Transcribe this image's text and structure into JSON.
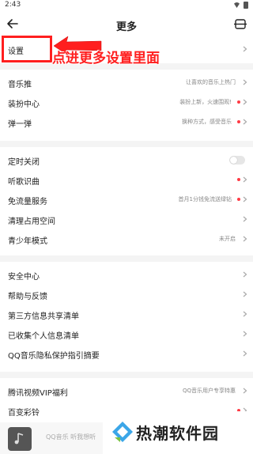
{
  "status_bar": {
    "time": "2:43"
  },
  "header": {
    "title": "更多"
  },
  "annotation": {
    "text": "点进更多设置里面"
  },
  "groups": [
    [
      {
        "label": "设置",
        "sub": "",
        "dot": false,
        "control": "chevron"
      }
    ],
    [
      {
        "label": "音乐推",
        "sub": "让喜欢的音乐上热门",
        "dot": false,
        "control": "chevron"
      },
      {
        "label": "装扮中心",
        "sub": "装扮上新，火速围观!",
        "dot": true,
        "control": "chevron"
      },
      {
        "label": "弹一弹",
        "sub": "换种方式，感受音乐",
        "dot": true,
        "control": "chevron"
      }
    ],
    [
      {
        "label": "定时关闭",
        "sub": "",
        "dot": false,
        "control": "toggle"
      },
      {
        "label": "听歌识曲",
        "sub": "",
        "dot": true,
        "control": "chevron"
      },
      {
        "label": "免流量服务",
        "sub": "首月1分钱免流送绿钻",
        "dot": true,
        "control": "chevron"
      },
      {
        "label": "清理占用空间",
        "sub": "",
        "dot": false,
        "control": "chevron"
      },
      {
        "label": "青少年模式",
        "sub": "未开启",
        "dot": false,
        "control": "chevron"
      }
    ],
    [
      {
        "label": "安全中心",
        "sub": "",
        "dot": false,
        "control": "chevron"
      },
      {
        "label": "帮助与反馈",
        "sub": "",
        "dot": false,
        "control": "chevron"
      },
      {
        "label": "第三方信息共享清单",
        "sub": "",
        "dot": false,
        "control": "chevron"
      },
      {
        "label": "已收集个人信息清单",
        "sub": "",
        "dot": false,
        "control": "chevron"
      },
      {
        "label": "QQ音乐隐私保护指引摘要",
        "sub": "",
        "dot": false,
        "control": "chevron"
      }
    ],
    [
      {
        "label": "腾讯视频VIP福利",
        "sub": "QQ音乐用户专享特惠",
        "dot": false,
        "control": "chevron"
      },
      {
        "label": "百变彩铃",
        "sub": "",
        "dot": true,
        "control": "chevron"
      }
    ]
  ],
  "mini_player": {
    "text": "QQ音乐 听我想听"
  },
  "watermark": {
    "text": "热潮软件园"
  },
  "colors": {
    "accent_red": "#ff1f1f",
    "dot_red": "#ff3a44",
    "divider": "#f4f4f4"
  }
}
